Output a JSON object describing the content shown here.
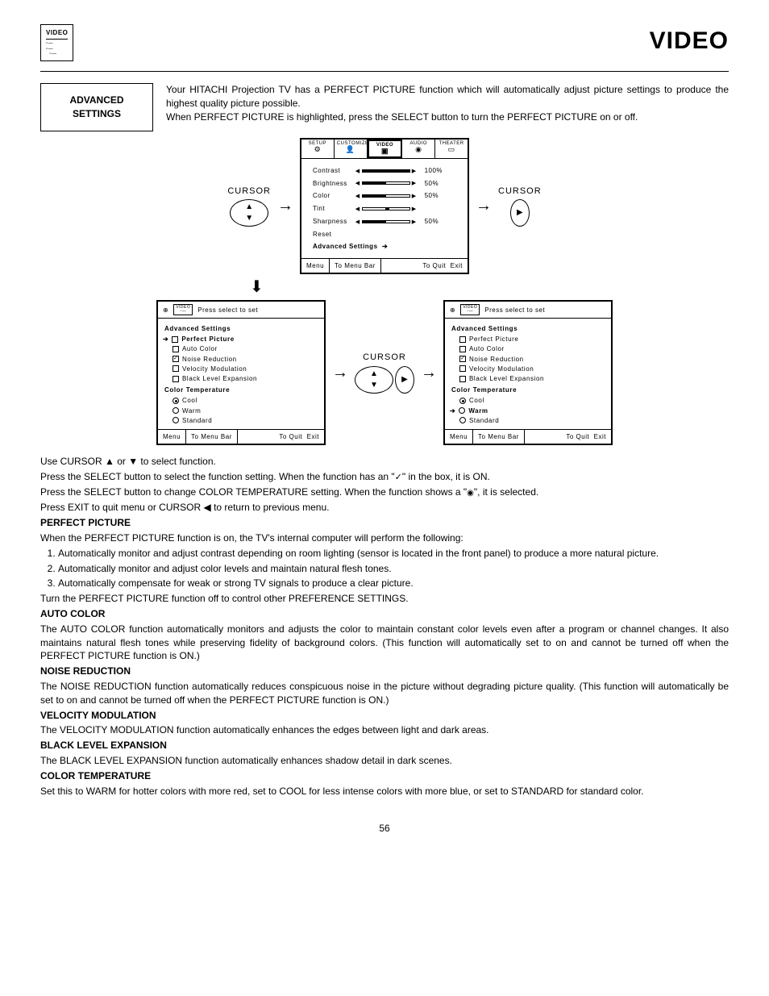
{
  "title": "VIDEO",
  "page_number": "56",
  "adv_box": {
    "line1": "ADVANCED",
    "line2": "SETTINGS"
  },
  "intro": {
    "p1": "Your HITACHI Projection TV has a PERFECT PICTURE function which will automatically adjust picture settings to produce the highest quality picture possible.",
    "p2": "When PERFECT PICTURE is highlighted, press the SELECT button to turn the PERFECT PICTURE on or off."
  },
  "cursor_label": "CURSOR",
  "osd_tabs": [
    "SETUP",
    "CUSTOMIZE",
    "VIDEO",
    "AUDIO",
    "THEATER"
  ],
  "osd_video": {
    "rows": [
      {
        "label": "Contrast",
        "barType": "full",
        "value": "100%"
      },
      {
        "label": "Brightness",
        "barType": "half",
        "value": "50%"
      },
      {
        "label": "Color",
        "barType": "half",
        "value": "50%"
      },
      {
        "label": "Tint",
        "barType": "center",
        "value": ""
      },
      {
        "label": "Sharpness",
        "barType": "half",
        "value": "50%"
      },
      {
        "label": "Reset",
        "barType": "",
        "value": ""
      }
    ],
    "adv": "Advanced Settings",
    "footer": {
      "menu": "Menu",
      "mid": "To Menu Bar",
      "quit": "To Quit",
      "exit": "Exit"
    }
  },
  "osd_sub_prompt": "Press select to set",
  "adv_settings": {
    "header": "Advanced Settings",
    "items": [
      {
        "key": "perfect",
        "label": "Perfect Picture",
        "type": "check"
      },
      {
        "key": "autocolor",
        "label": "Auto Color",
        "type": "check"
      },
      {
        "key": "noise",
        "label": "Noise Reduction",
        "type": "check"
      },
      {
        "key": "velocity",
        "label": "Velocity Modulation",
        "type": "check"
      },
      {
        "key": "black",
        "label": "Black Level Expansion",
        "type": "check"
      }
    ],
    "ct_header": "Color Temperature",
    "ct": [
      {
        "key": "cool",
        "label": "Cool"
      },
      {
        "key": "warm",
        "label": "Warm"
      },
      {
        "key": "standard",
        "label": "Standard"
      }
    ]
  },
  "instructions": {
    "p1": "Use CURSOR ▲ or ▼ to select function.",
    "p2_a": "Press the SELECT button to select the function setting. When the function has an \"",
    "p2_b": "\" in the box, it is ON.",
    "p3_a": "Press the SELECT button to change COLOR TEMPERATURE setting.  When the function shows a \"",
    "p3_b": "\", it is selected.",
    "p4": "Press EXIT to quit menu or CURSOR ◀ to return to previous menu."
  },
  "sections": {
    "perfect": {
      "h": "PERFECT PICTURE",
      "intro": "When the PERFECT PICTURE function is on, the TV's internal computer will perform the following:",
      "li1": "Automatically monitor and adjust contrast depending on room lighting (sensor is located in the front panel) to produce a more natural picture.",
      "li2": "Automatically monitor and adjust color levels and maintain natural flesh tones.",
      "li3": "Automatically compensate for weak or strong TV signals to produce a clear picture.",
      "outro": "Turn the PERFECT PICTURE function off to control other PREFERENCE SETTINGS."
    },
    "autocolor": {
      "h": "AUTO COLOR",
      "p": "The AUTO COLOR function automatically monitors and adjusts the color to maintain constant color levels even after a program or channel changes. It also maintains natural flesh tones while preserving fidelity of background colors. (This function will automatically set to on and cannot be turned off when the PERFECT PICTURE function is ON.)"
    },
    "noise": {
      "h": "NOISE REDUCTION",
      "p": "The NOISE REDUCTION function automatically reduces conspicuous noise in the picture without degrading picture quality. (This function will automatically be set to on and cannot be turned off when the PERFECT PICTURE function is ON.)"
    },
    "velocity": {
      "h": "VELOCITY MODULATION",
      "p": "The VELOCITY MODULATION function automatically enhances the edges between light and dark areas."
    },
    "black": {
      "h": "BLACK LEVEL EXPANSION",
      "p": "The BLACK LEVEL EXPANSION function automatically enhances shadow detail in dark scenes."
    },
    "colortemp": {
      "h": "COLOR TEMPERATURE",
      "p": "Set this to WARM for hotter colors with more red, set to COOL for less intense colors with more blue, or set to STANDARD for standard color."
    }
  }
}
